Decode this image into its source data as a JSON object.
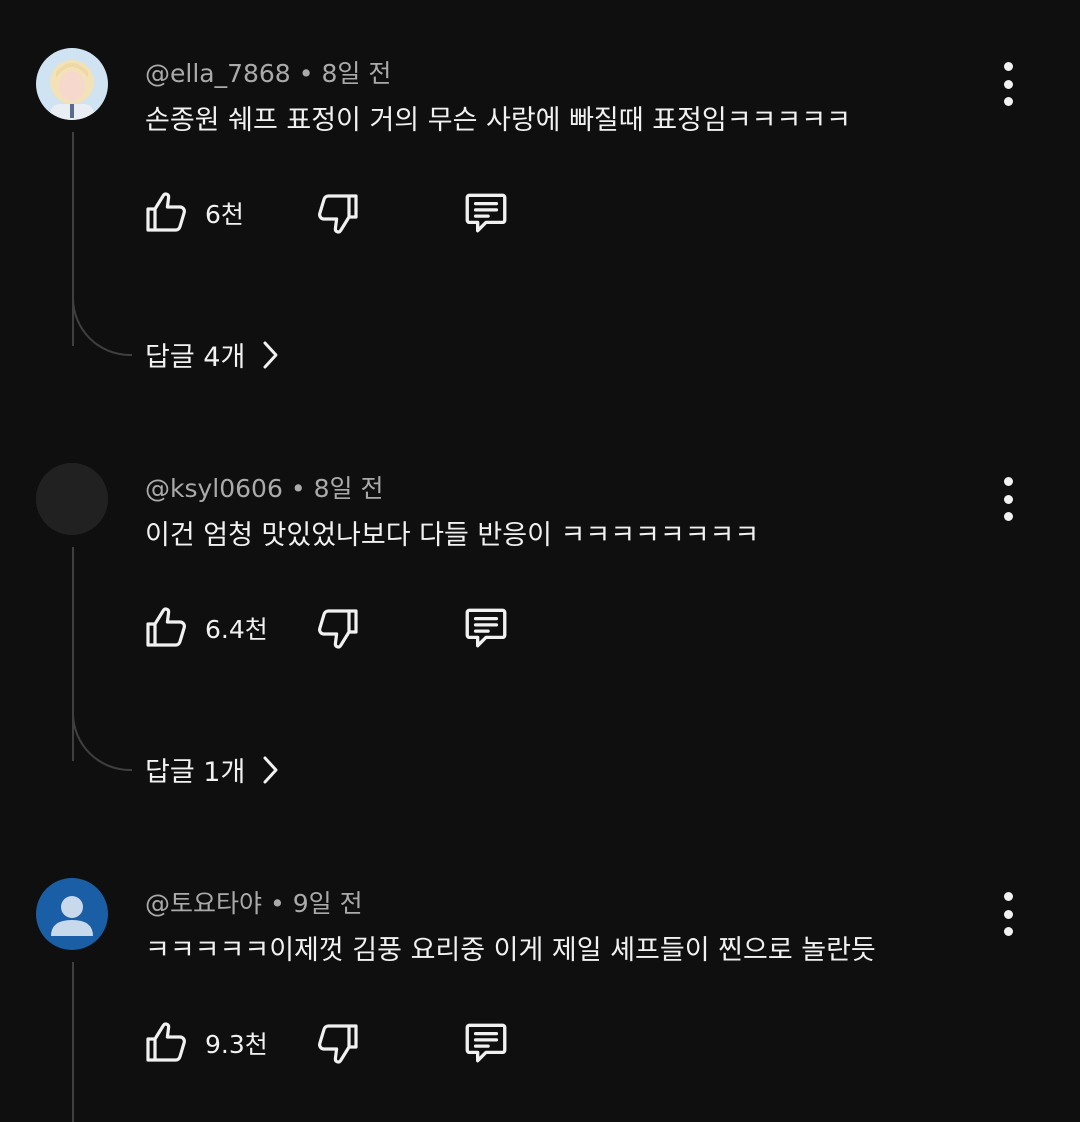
{
  "comments": [
    {
      "handle": "@ella_7868",
      "age": "8일 전",
      "text": "손종원 쉐프 표정이 거의 무슨 사랑에 빠질때 표정임ㅋㅋㅋㅋㅋ",
      "likes": "6천",
      "replies_label": "답글 4개",
      "avatar_icon": "photo-avatar"
    },
    {
      "handle": "@ksyl0606",
      "age": "8일 전",
      "text": "이건 엄청 맛있었나보다 다들 반응이 ㅋㅋㅋㅋㅋㅋㅋㅋ",
      "likes": "6.4천",
      "replies_label": "답글 1개",
      "avatar_icon": "blank-avatar"
    },
    {
      "handle": "@토요타야",
      "age": "9일 전",
      "text": "ㅋㅋㅋㅋㅋ이제껏 김풍 요리중 이게 제일 셰프들이 찐으로 놀란듯",
      "likes": "9.3천",
      "avatar_icon": "default-person-avatar"
    }
  ],
  "meta_separator": "•",
  "colors": {
    "background": "#0f0f0f",
    "text_primary": "#f1f1f1",
    "text_secondary": "#aaaaaa",
    "thread_line": "#3f3f3f",
    "default_avatar_blue": "#1a5fa6"
  }
}
